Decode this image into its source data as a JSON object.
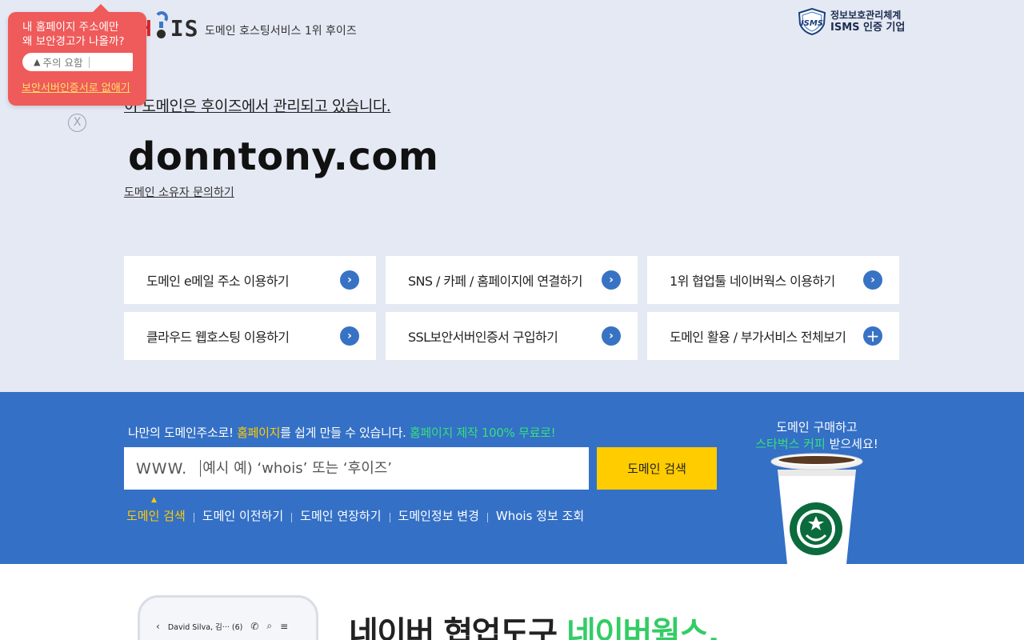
{
  "header": {
    "logo_text": "WHOIS",
    "tagline": "도메인 호스팅서비스 1위 후이즈",
    "isms_line1": "정보보호관리체계",
    "isms_line2": "ISMS 인증 기업",
    "isms_badge_label": "ISMS"
  },
  "warning_popup": {
    "question_line1": "내 홈페이지 주소에만",
    "question_line2": "왜 보안경고가 나올까?",
    "caution_label": "주의 요함",
    "link_label": "보안서버인증서로 없애기",
    "close_label": "X"
  },
  "hero": {
    "notice": "이 도메인은 후이즈에서 관리되고 있습니다.",
    "domain": "donntony.com",
    "owner_link": "도메인 소유자 문의하기"
  },
  "services": [
    {
      "label": "도메인 e메일 주소 이용하기",
      "icon": "chevron-right-icon"
    },
    {
      "label": "SNS / 카페 / 홈페이지에 연결하기",
      "icon": "chevron-right-icon"
    },
    {
      "label": "1위 협업툴 네이버웍스 이용하기",
      "icon": "chevron-right-icon"
    },
    {
      "label": "클라우드 웹호스팅 이용하기",
      "icon": "chevron-right-icon"
    },
    {
      "label": "SSL보안서버인증서 구입하기",
      "icon": "chevron-right-icon"
    },
    {
      "label": "도메인 활용 / 부가서비스 전체보기",
      "icon": "plus-icon"
    }
  ],
  "search": {
    "promo_a": "나만의 도메인주소로!",
    "promo_b": "홈페이지",
    "promo_c": "를 쉽게 만들 수 있습니다.",
    "promo_d": "홈페이지 제작 100% 무료로!",
    "prefix": "WWW.",
    "placeholder": "예시 예) ‘whois’ 또는 ‘후이즈’",
    "button_label": "도메인 검색",
    "tabs": [
      "도메인 검색",
      "도메인 이전하기",
      "도메인 연장하기",
      "도메인정보 변경",
      "Whois 정보 조회"
    ],
    "active_tab": 0
  },
  "coffee": {
    "line1": "도메인 구매하고",
    "line2_green": "스타벅스 커피",
    "line2_rest": " 받으세요!"
  },
  "bottom": {
    "phone_contact": "David Silva, 김··· (6)",
    "headline_a": "네이버 협업도구 ",
    "headline_b": "네이버웍스,"
  },
  "colors": {
    "background": "#e5e9f4",
    "band": "#3470c6",
    "accent_yellow": "#ffcc00",
    "accent_green": "#36e07a",
    "warning": "#ef5a5a",
    "card_icon": "#3872c4"
  }
}
